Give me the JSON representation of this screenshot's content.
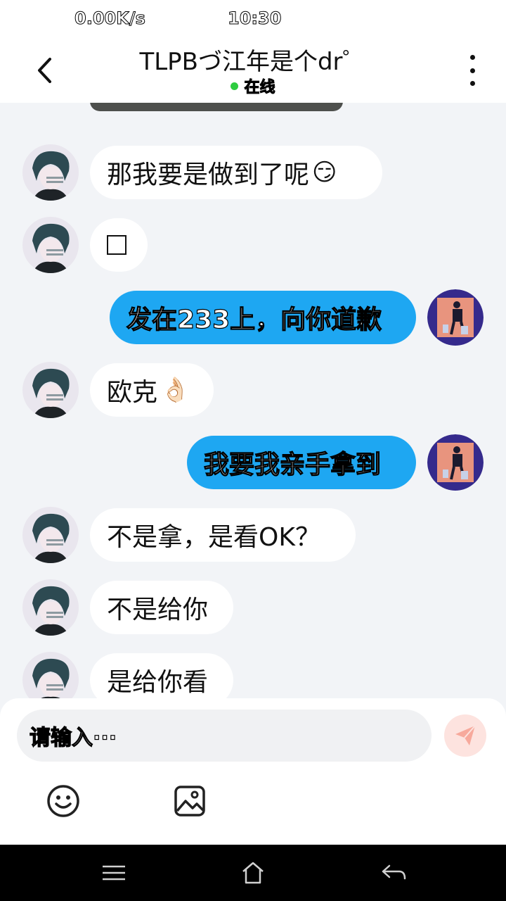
{
  "status_bar": {
    "speed": "0.00K/s",
    "time": "10:30"
  },
  "header": {
    "title": "TLPBづ江年是个dr゜",
    "status": "在线",
    "back_icon": "chevron-left-icon",
    "more_icon": "more-vertical-icon"
  },
  "messages": [
    {
      "side": "in",
      "text": "那我要是做到了呢",
      "emoji": "😏"
    },
    {
      "side": "in",
      "text": "",
      "has_box": true
    },
    {
      "side": "out",
      "text": "发在233上，向你道歉"
    },
    {
      "side": "in",
      "text": "欧克",
      "emoji": "👌🏻"
    },
    {
      "side": "out",
      "text": "我要我亲手拿到"
    },
    {
      "side": "in",
      "text": "不是拿，是看OK？"
    },
    {
      "side": "in",
      "text": "不是给你"
    },
    {
      "side": "in",
      "text": "是给你看"
    }
  ],
  "input": {
    "placeholder": "请输入···"
  },
  "toolbar": {
    "emoji_icon": "smiley-icon",
    "image_icon": "image-icon",
    "send_icon": "send-icon"
  },
  "navbar": {
    "menu_icon": "menu-icon",
    "home_icon": "home-icon",
    "back_icon": "back-arrow-icon"
  },
  "colors": {
    "accent": "#1ea7f2",
    "online": "#2ecc40",
    "send_bg": "#fde3df",
    "send_icon": "#f7a99c"
  }
}
